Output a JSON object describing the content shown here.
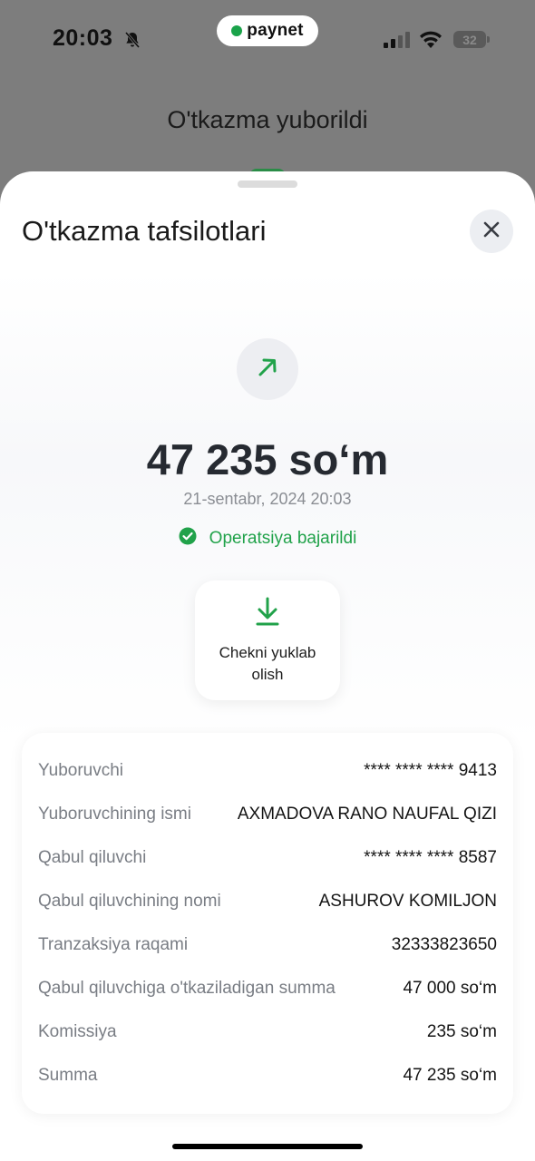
{
  "status_bar": {
    "time": "20:03",
    "brand": "paynet",
    "battery": "32"
  },
  "background": {
    "title": "O'tkazma yuborildi"
  },
  "sheet": {
    "title": "O'tkazma tafsilotlari",
    "amount": "47 235 so‘m",
    "date": "21-sentabr, 2024 20:03",
    "status": "Operatsiya bajarildi",
    "download_label": "Chekni yuklab olish"
  },
  "details": [
    {
      "label": "Yuboruvchi",
      "value": "**** **** **** 9413"
    },
    {
      "label": "Yuboruvchining ismi",
      "value": "AXMADOVA RANO NAUFAL QIZI"
    },
    {
      "label": "Qabul qiluvchi",
      "value": "**** **** **** 8587"
    },
    {
      "label": "Qabul qiluvchining nomi",
      "value": "ASHUROV KOMILJON"
    },
    {
      "label": "Tranzaksiya raqami",
      "value": "32333823650"
    },
    {
      "label": "Qabul qiluvchiga o'tkaziladigan summa",
      "value": "47 000 so‘m"
    },
    {
      "label": "Komissiya",
      "value": "235 so‘m"
    },
    {
      "label": "Summa",
      "value": "47 235 so‘m"
    }
  ],
  "colors": {
    "accent_green": "#21a24a",
    "overlay": "#7d7d7d"
  },
  "icons": {
    "close": "close-icon",
    "arrow": "arrow-up-right-icon",
    "check": "check-circle-icon",
    "download": "download-icon"
  }
}
